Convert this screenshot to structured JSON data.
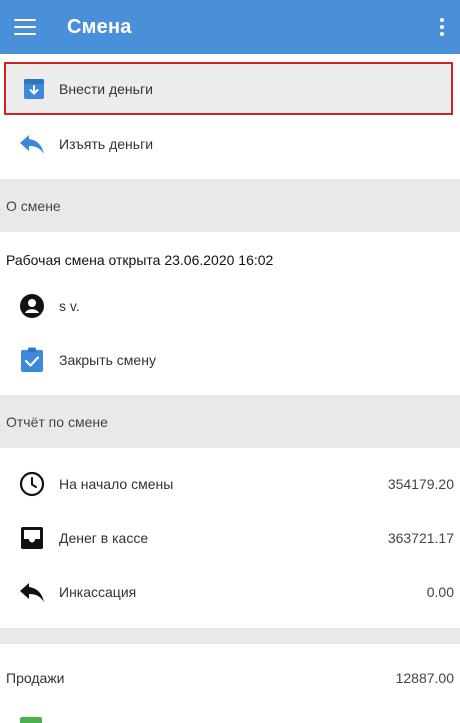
{
  "appbar": {
    "title": "Смена",
    "menu_icon": "hamburger-menu-icon",
    "more_icon": "more-vert-icon"
  },
  "actions": [
    {
      "label": "Внести деньги",
      "icon": "deposit-icon",
      "selected": true
    },
    {
      "label": "Изъять деньги",
      "icon": "withdraw-reply-icon"
    }
  ],
  "shift": {
    "section_title": "О смене",
    "status": "Рабочая смена открыта 23.06.2020 16:02",
    "user": "s v.",
    "close_label": "Закрыть смену"
  },
  "report": {
    "section_title": "Отчёт по смене",
    "rows": [
      {
        "label": "На начало смены",
        "value": "354179.20",
        "icon": "clock-icon"
      },
      {
        "label": "Денег в кассе",
        "value": "363721.17",
        "icon": "inbox-tray-icon"
      },
      {
        "label": "Инкассация",
        "value": "0.00",
        "icon": "reply-arrow-icon"
      }
    ]
  },
  "sales": {
    "label": "Продажи",
    "value": "12887.00"
  },
  "colors": {
    "appbar": "#4a90d9",
    "accent": "#3b8ad9",
    "highlight_border": "#d42222",
    "section_bg": "#e9e9e9"
  }
}
